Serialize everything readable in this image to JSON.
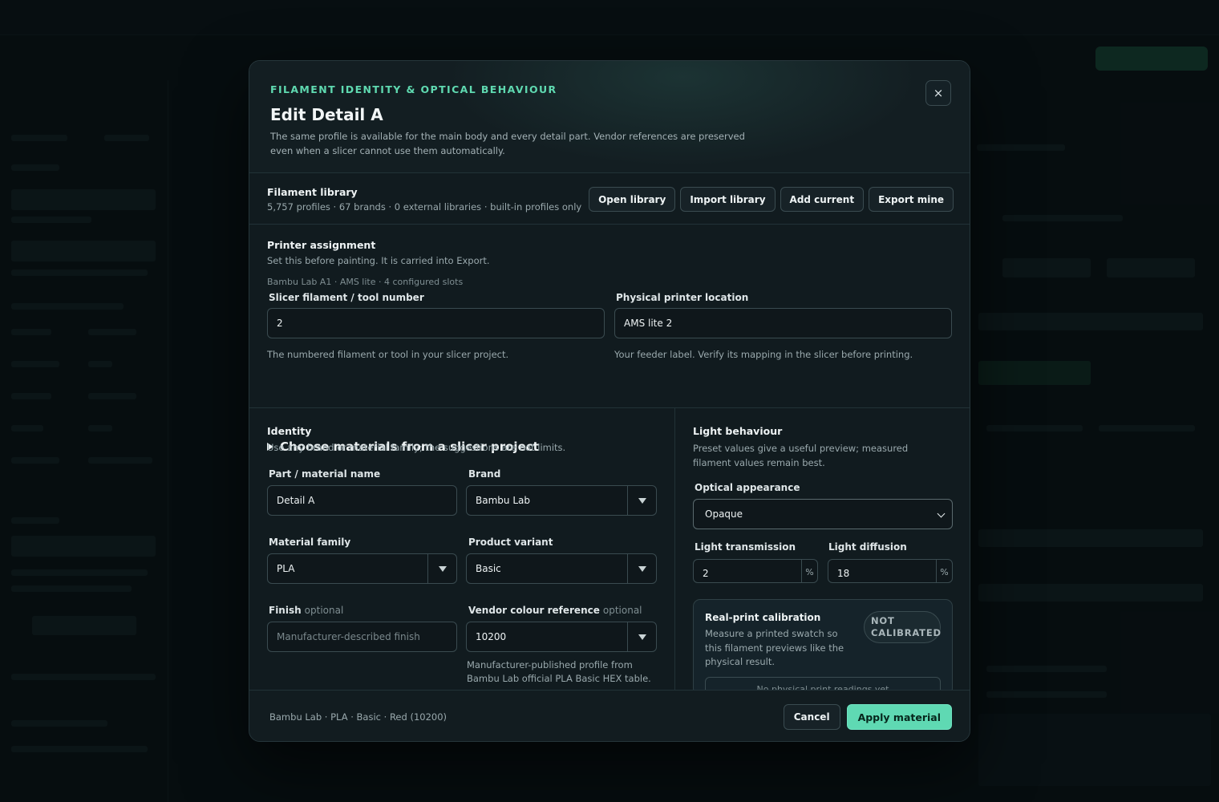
{
  "modal": {
    "eyebrow": "FILAMENT IDENTITY & OPTICAL BEHAVIOUR",
    "title": "Edit Detail A",
    "subtitle": "The same profile is available for the main body and every detail part. Vendor references are preserved even when a slicer cannot use them automatically.",
    "close_icon": "close-icon",
    "close_glyph": "×"
  },
  "library": {
    "title": "Filament library",
    "summary": "5,757 profiles · 67 brands · 0 external libraries · built-in profiles only",
    "buttons": {
      "open": "Open library",
      "import": "Import library",
      "add": "Add current",
      "export": "Export mine"
    }
  },
  "printer": {
    "title": "Printer assignment",
    "description": "Set this before painting. It is carried into Export.",
    "meta": "Bambu Lab A1 · AMS lite · 4 configured slots",
    "tool_label": "Slicer filament / tool number",
    "tool_value": "2",
    "tool_hint": "The numbered filament or tool in your slicer project.",
    "location_label": "Physical printer location",
    "location_value": "AMS lite 2",
    "location_hint": "Your feeder label. Verify its mapping in the slicer before printing.",
    "disclosure": "Choose materials from a slicer project"
  },
  "identity": {
    "title": "Identity",
    "description": "Use any brand or material family; the suggestions are not limits.",
    "name_label": "Part / material name",
    "name_value": "Detail A",
    "brand_label": "Brand",
    "brand_value": "Bambu Lab",
    "family_label": "Material family",
    "family_value": "PLA",
    "variant_label": "Product variant",
    "variant_value": "Basic",
    "finish_label": "Finish",
    "finish_optional": "optional",
    "finish_placeholder": "Manufacturer-described finish",
    "vendor_label": "Vendor colour reference",
    "vendor_optional": "optional",
    "vendor_value": "10200",
    "vendor_hint": "Manufacturer-published profile from Bambu Lab official PLA Basic HEX table."
  },
  "light": {
    "title": "Light behaviour",
    "description": "Preset values give a useful preview; measured filament values remain best.",
    "appearance_label": "Optical appearance",
    "appearance_value": "Opaque",
    "transmission_label": "Light transmission",
    "transmission_value": "2",
    "diffusion_label": "Light diffusion",
    "diffusion_value": "18",
    "unit": "%"
  },
  "calibration": {
    "title": "Real-print calibration",
    "description": "Measure a printed swatch so this filament previews like the physical result.",
    "badge": "NOT CALIBRATED",
    "empty": "No physical print readings yet"
  },
  "footer": {
    "summary": "Bambu Lab · PLA · Basic · Red (10200)",
    "cancel": "Cancel",
    "apply": "Apply material"
  },
  "colors": {
    "accent": "#5fd9b3",
    "modal_bg": "#111b1f",
    "border": "#3a4b50"
  }
}
